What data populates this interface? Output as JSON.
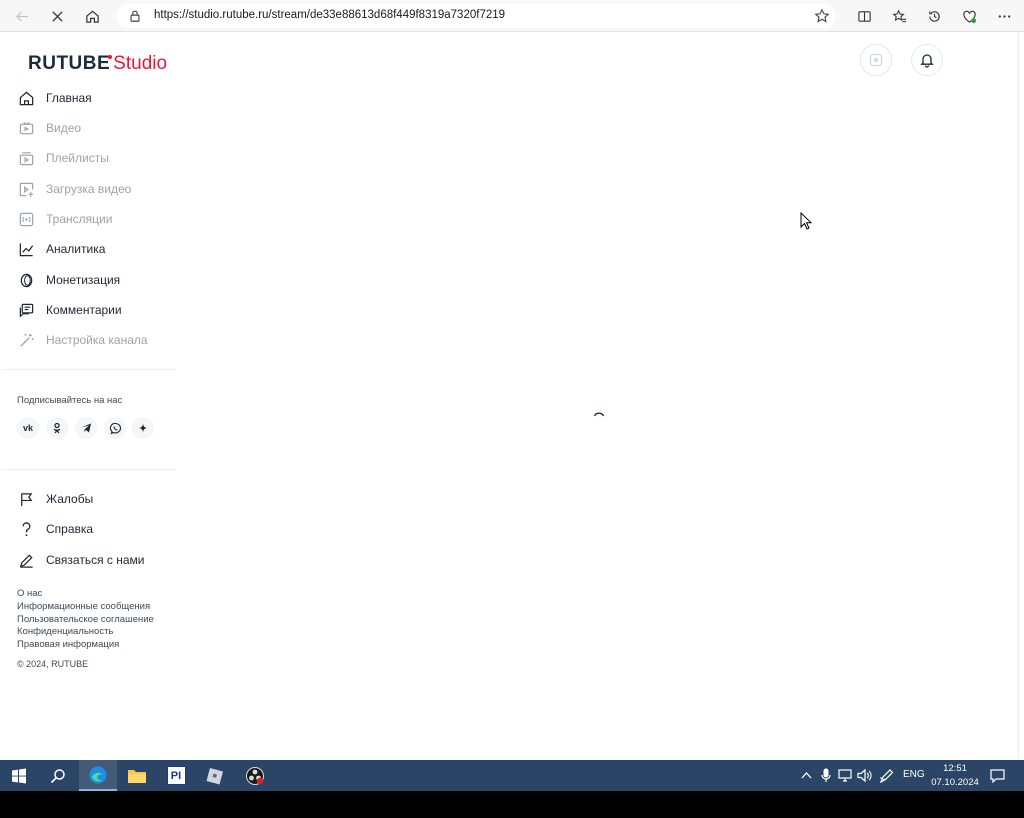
{
  "browser": {
    "url": "https://studio.rutube.ru/stream/de33e88613d68f449f8319a7320f7219"
  },
  "logo": {
    "rutube": "RUTUBE",
    "studio": "Studio"
  },
  "sidebar": {
    "items": [
      {
        "label": "Главная",
        "icon": "home-icon",
        "enabled": true
      },
      {
        "label": "Видео",
        "icon": "video-icon",
        "enabled": false
      },
      {
        "label": "Плейлисты",
        "icon": "playlist-icon",
        "enabled": false
      },
      {
        "label": "Загрузка видео",
        "icon": "upload-video-icon",
        "enabled": false
      },
      {
        "label": "Трансляции",
        "icon": "broadcast-icon",
        "enabled": false
      },
      {
        "label": "Аналитика",
        "icon": "analytics-icon",
        "enabled": true
      },
      {
        "label": "Монетизация",
        "icon": "monetization-icon",
        "enabled": true
      },
      {
        "label": "Комментарии",
        "icon": "comments-icon",
        "enabled": true
      },
      {
        "label": "Настройка канала",
        "icon": "magic-wand-icon",
        "enabled": false
      }
    ],
    "social_title": "Подписывайтесь на нас",
    "social": [
      "vk",
      "odnoklassniki",
      "telegram",
      "viber",
      "more"
    ],
    "bottom_items": [
      {
        "label": "Жалобы",
        "icon": "flag-icon"
      },
      {
        "label": "Справка",
        "icon": "help-icon"
      },
      {
        "label": "Связаться с нами",
        "icon": "pencil-icon"
      }
    ],
    "footer_links": [
      "О нас",
      "Информационные сообщения",
      "Пользовательское соглашение",
      "Конфиденциальность",
      "Правовая информация"
    ],
    "copyright": "© 2024, RUTUBE"
  },
  "taskbar": {
    "lang": "ENG",
    "time": "12:51",
    "date": "07.10.2024"
  },
  "colors": {
    "brand_red": "#ed143b",
    "brand_dark": "#1c2a3a",
    "taskbar": "#2b4566"
  }
}
